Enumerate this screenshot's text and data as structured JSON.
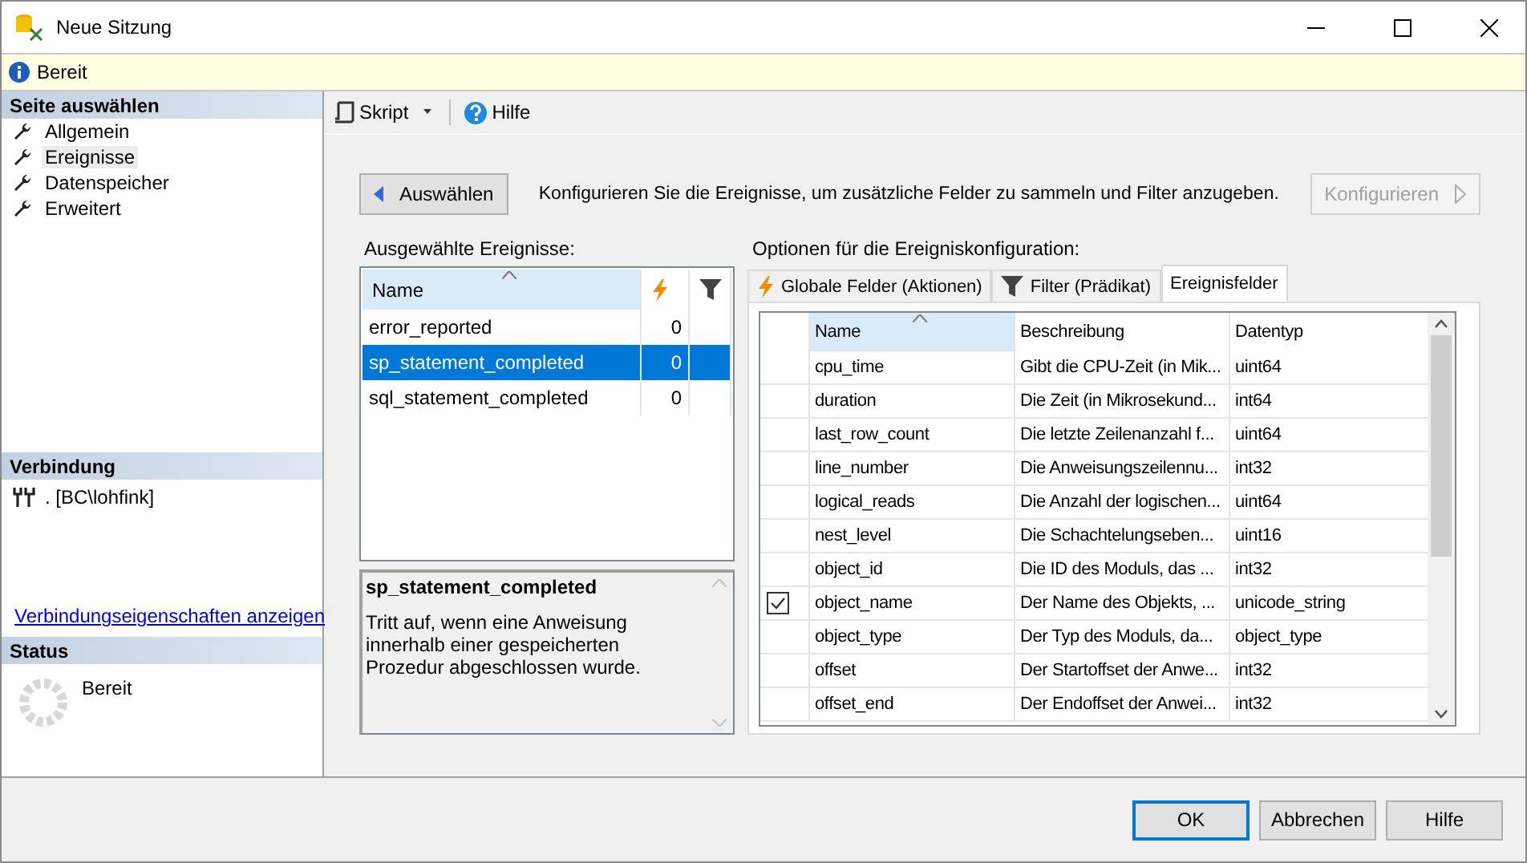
{
  "window": {
    "title": "Neue Sitzung"
  },
  "info_bar": {
    "text": "Bereit"
  },
  "sidebar": {
    "heading": "Seite auswählen",
    "items": [
      {
        "label": "Allgemein",
        "selected": false
      },
      {
        "label": "Ereignisse",
        "selected": true
      },
      {
        "label": "Datenspeicher",
        "selected": false
      },
      {
        "label": "Erweitert",
        "selected": false
      }
    ]
  },
  "connection": {
    "heading": "Verbindung",
    "server": ". [BC\\lohfink]",
    "link": "Verbindungseigenschaften anzeigen"
  },
  "status": {
    "heading": "Status",
    "text": "Bereit"
  },
  "toolbar": {
    "script": "Skript",
    "help": "Hilfe"
  },
  "nav": {
    "back": "Auswählen",
    "description": "Konfigurieren Sie die Ereignisse, um zusätzliche Felder zu sammeln und Filter anzugeben.",
    "configure": "Konfigurieren",
    "configure_disabled": true
  },
  "selected_events": {
    "label": "Ausgewählte Ereignisse:",
    "column": "Name",
    "rows": [
      {
        "name": "error_reported",
        "count": "0",
        "selected": false
      },
      {
        "name": "sp_statement_completed",
        "count": "0",
        "selected": true
      },
      {
        "name": "sql_statement_completed",
        "count": "0",
        "selected": false
      }
    ]
  },
  "event_description": {
    "title": "sp_statement_completed",
    "text": "Tritt auf, wenn eine Anweisung innerhalb einer gespeicherten Prozedur abgeschlossen wurde."
  },
  "options": {
    "label": "Optionen für die Ereigniskonfiguration:",
    "tabs": [
      {
        "label": "Globale Felder (Aktionen)",
        "kind": "actions",
        "selected": false
      },
      {
        "label": "Filter (Prädikat)",
        "kind": "filter",
        "selected": false
      },
      {
        "label": "Ereignisfelder",
        "kind": "plain",
        "selected": true
      }
    ],
    "columns": [
      "Name",
      "Beschreibung",
      "Datentyp"
    ],
    "rows": [
      {
        "checked": false,
        "name": "cpu_time",
        "description": "Gibt die CPU-Zeit (in Mik...",
        "type": "uint64"
      },
      {
        "checked": false,
        "name": "duration",
        "description": "Die Zeit (in Mikrosekund...",
        "type": "int64"
      },
      {
        "checked": false,
        "name": "last_row_count",
        "description": "Die letzte Zeilenanzahl f...",
        "type": "uint64"
      },
      {
        "checked": false,
        "name": "line_number",
        "description": "Die Anweisungszeilennu...",
        "type": "int32"
      },
      {
        "checked": false,
        "name": "logical_reads",
        "description": "Die Anzahl der logischen...",
        "type": "uint64"
      },
      {
        "checked": false,
        "name": "nest_level",
        "description": "Die Schachtelungseben...",
        "type": "uint16"
      },
      {
        "checked": false,
        "name": "object_id",
        "description": "Die ID des Moduls, das ...",
        "type": "int32"
      },
      {
        "checked": true,
        "name": "object_name",
        "description": "Der Name des Objekts, ...",
        "type": "unicode_string"
      },
      {
        "checked": false,
        "name": "object_type",
        "description": "Der Typ des Moduls, da...",
        "type": "object_type"
      },
      {
        "checked": false,
        "name": "offset",
        "description": "Der Startoffset der Anwe...",
        "type": "int32"
      },
      {
        "checked": false,
        "name": "offset_end",
        "description": "Der Endoffset der Anwei...",
        "type": "int32"
      }
    ]
  },
  "footer": {
    "buttons": [
      {
        "label": "OK",
        "default": true
      },
      {
        "label": "Abbrechen",
        "default": false
      },
      {
        "label": "Hilfe",
        "default": false
      }
    ]
  }
}
